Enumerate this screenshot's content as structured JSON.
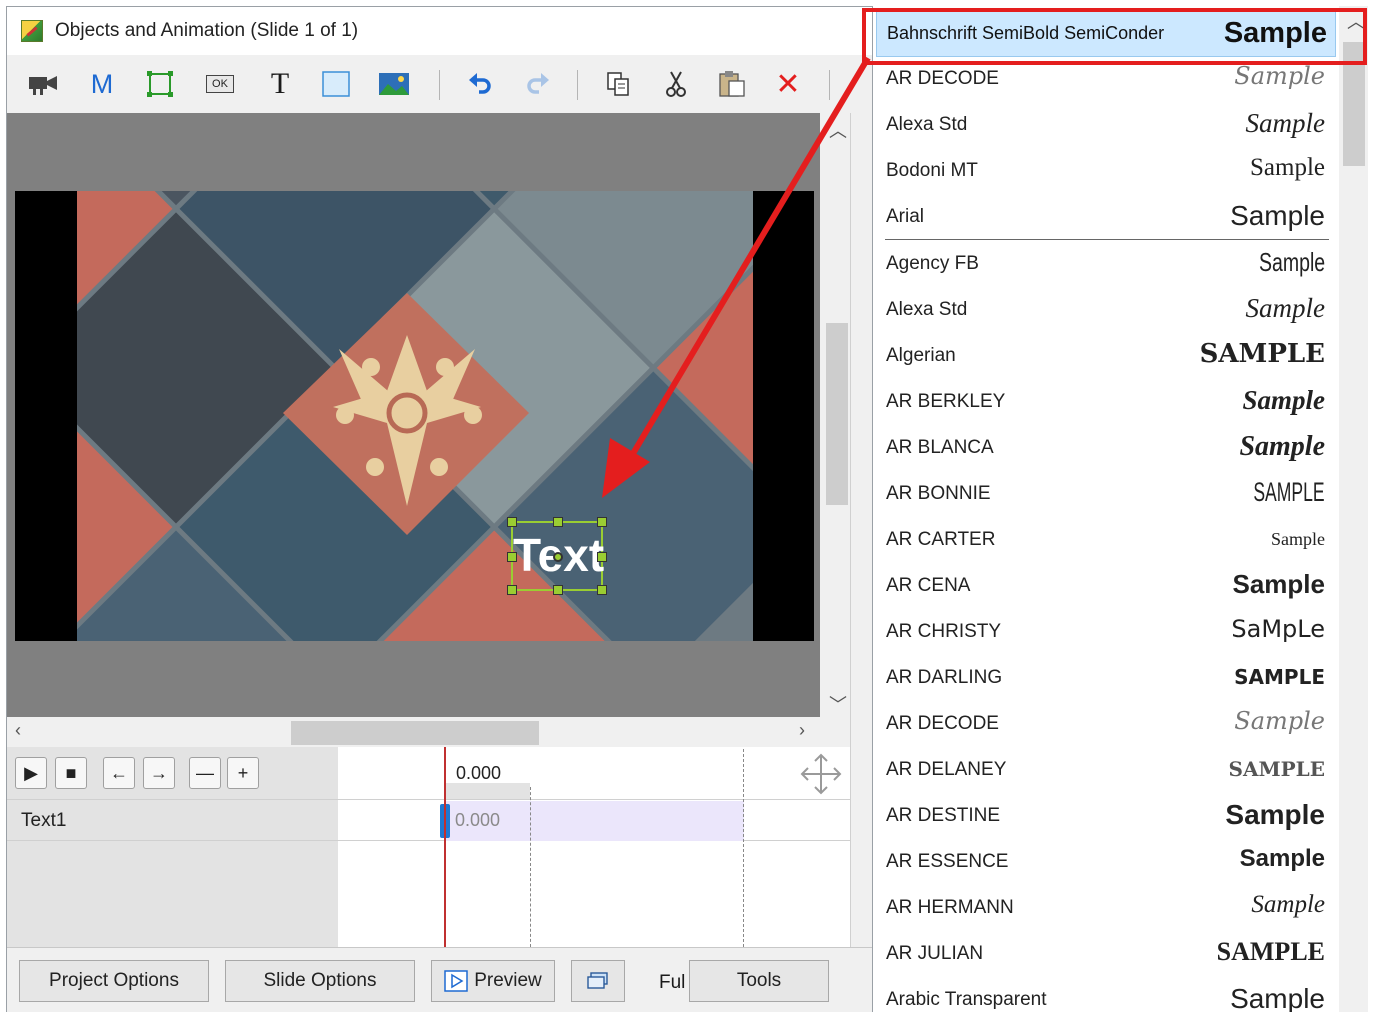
{
  "window": {
    "title": "Objects and Animation (Slide 1 of 1)"
  },
  "toolbar": {
    "image_button_icon": "camera-icon",
    "m_label": "M",
    "ok_label": "OK",
    "t_label": "T",
    "delete_label": "✕"
  },
  "canvas": {
    "object_text": "Text"
  },
  "timeline": {
    "ruler_time": "0.000",
    "track_name": "Text1",
    "track_time": "0.000",
    "buttons": [
      "▶",
      "■",
      "←",
      "→",
      "—",
      "+"
    ]
  },
  "bottom_bar": {
    "project_options": "Project Options",
    "slide_options": "Slide Options",
    "preview": "Preview",
    "full": "Ful",
    "tools": "Tools"
  },
  "font_dropdown": {
    "selected": {
      "name": "Bahnschrift SemiBold SemiConder",
      "sample": "Sample"
    },
    "recent": [
      {
        "name": "AR DECODE",
        "sample": "Sample"
      },
      {
        "name": "Alexa Std",
        "sample": "Sample"
      },
      {
        "name": "Bodoni MT",
        "sample": "Sample"
      },
      {
        "name": "Arial",
        "sample": "Sample"
      }
    ],
    "fonts": [
      {
        "name": "Agency FB",
        "sample": "Sample"
      },
      {
        "name": "Alexa Std",
        "sample": "Sample"
      },
      {
        "name": "Algerian",
        "sample": "SAMPLE"
      },
      {
        "name": "AR BERKLEY",
        "sample": "Sample"
      },
      {
        "name": "AR BLANCA",
        "sample": "Sample"
      },
      {
        "name": "AR BONNIE",
        "sample": "SAMPLE"
      },
      {
        "name": "AR CARTER",
        "sample": "Sample"
      },
      {
        "name": "AR CENA",
        "sample": "Sample"
      },
      {
        "name": "AR CHRISTY",
        "sample": "SaMpLe"
      },
      {
        "name": "AR DARLING",
        "sample": "SAMPLE"
      },
      {
        "name": "AR DECODE",
        "sample": "Sample"
      },
      {
        "name": "AR DELANEY",
        "sample": "SAMPLE"
      },
      {
        "name": "AR DESTINE",
        "sample": "Sample"
      },
      {
        "name": "AR ESSENCE",
        "sample": "Sample"
      },
      {
        "name": "AR HERMANN",
        "sample": "Sample"
      },
      {
        "name": "AR JULIAN",
        "sample": "SAMPLE"
      },
      {
        "name": "Arabic Transparent",
        "sample": "Sample"
      }
    ]
  },
  "colors": {
    "highlight": "#e41e1e",
    "selection": "#cce8ff",
    "playhead": "#c03030",
    "track_handle": "#1e78d2"
  }
}
